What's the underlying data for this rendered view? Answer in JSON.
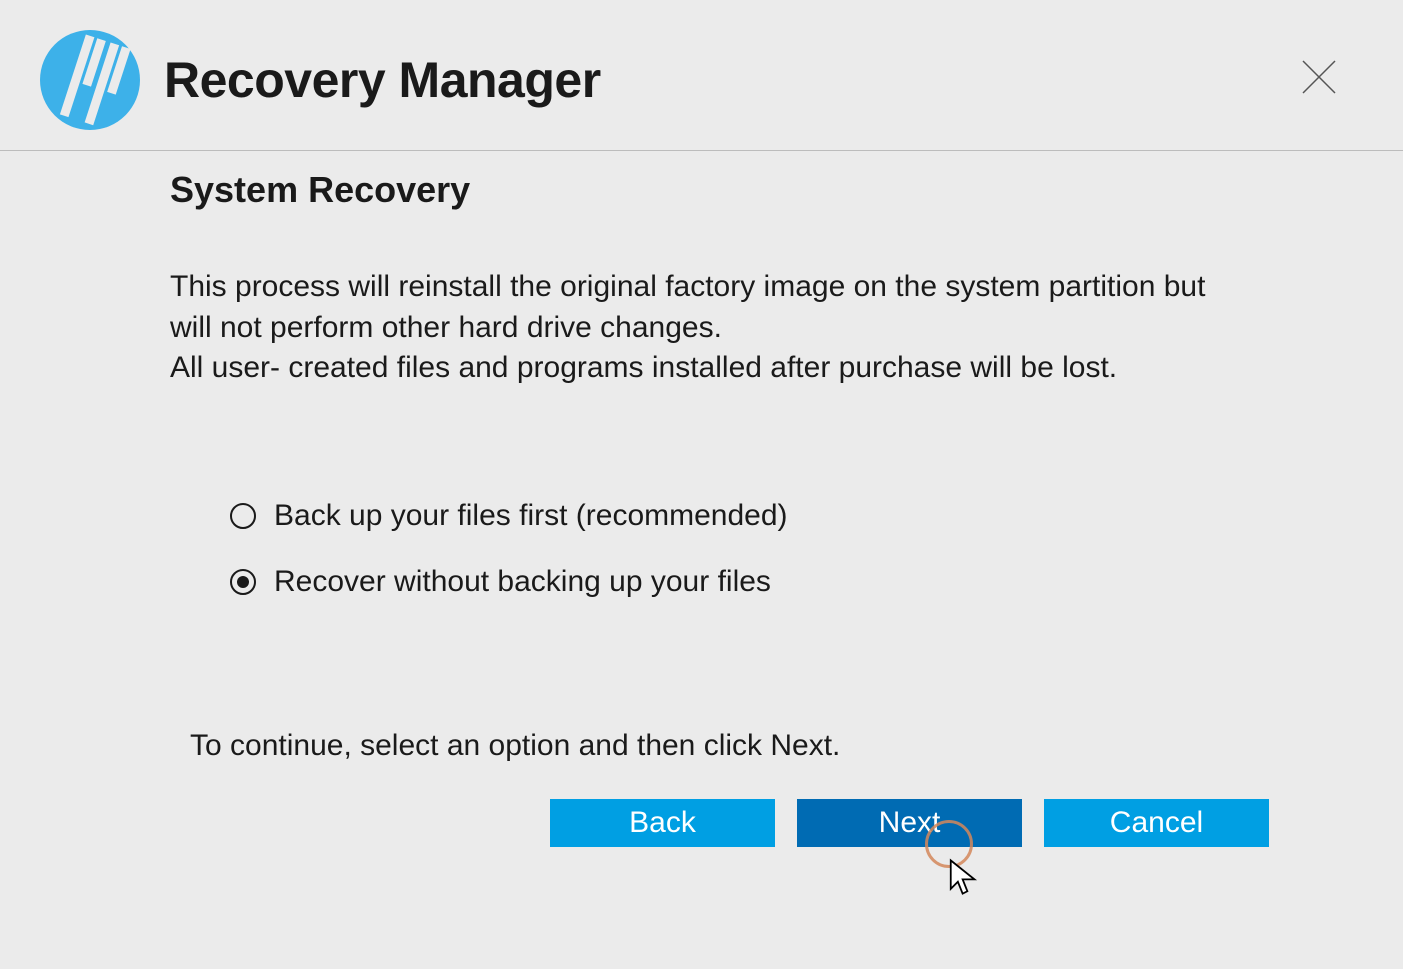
{
  "header": {
    "app_title": "Recovery Manager"
  },
  "page": {
    "title": "System Recovery",
    "description_line1": "This process will reinstall the original factory image on the system partition but will not perform other hard drive changes.",
    "description_line2": "All user- created files and programs installed after purchase will be lost.",
    "hint": "To continue, select an option and then click Next."
  },
  "options": [
    {
      "label": "Back up your files first (recommended)",
      "selected": false
    },
    {
      "label": "Recover without backing up your files",
      "selected": true
    }
  ],
  "buttons": {
    "back": "Back",
    "next": "Next",
    "cancel": "Cancel"
  },
  "colors": {
    "brand": "#009fe3",
    "brand_active": "#006bb3"
  }
}
